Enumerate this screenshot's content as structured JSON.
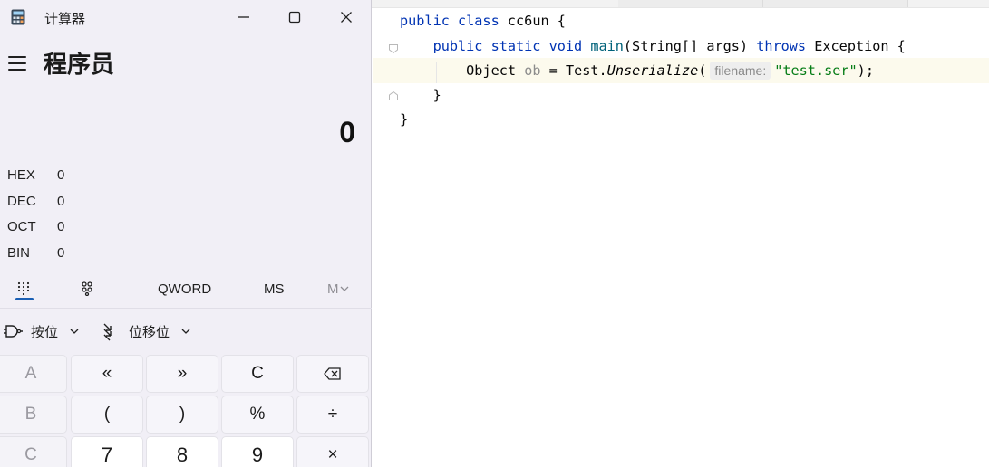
{
  "editor": {
    "line1": {
      "kw": "public class",
      "name": "cc6un",
      "brace": "{"
    },
    "line2": {
      "kw1": "public static void",
      "fn": "main",
      "params": "(String[] args)",
      "kw2": "throws",
      "exc": "Exception {"
    },
    "line3": {
      "type": "Object",
      "var": "ob",
      "eq": "=",
      "cls": "Test.",
      "method": "Unserialize",
      "open": "(",
      "hint": "filename:",
      "arg": "\"test.ser\"",
      "close": ");"
    },
    "line4": "}",
    "line5": "}"
  },
  "calculator": {
    "title": "计算器",
    "mode": "程序员",
    "display_value": "0",
    "radix": [
      {
        "label": "HEX",
        "value": "0"
      },
      {
        "label": "DEC",
        "value": "0"
      },
      {
        "label": "OCT",
        "value": "0"
      },
      {
        "label": "BIN",
        "value": "0"
      }
    ],
    "toolbar": {
      "word": "QWORD",
      "ms": "MS",
      "mlist": "M"
    },
    "bitwise_label": "按位",
    "bitshift_label": "位移位",
    "keys": {
      "r1": [
        "A",
        "«",
        "»",
        "C",
        "backspace"
      ],
      "r2": [
        "B",
        "(",
        ")",
        "%",
        "÷"
      ],
      "r3": [
        "C",
        "7",
        "8",
        "9",
        "×"
      ]
    }
  }
}
